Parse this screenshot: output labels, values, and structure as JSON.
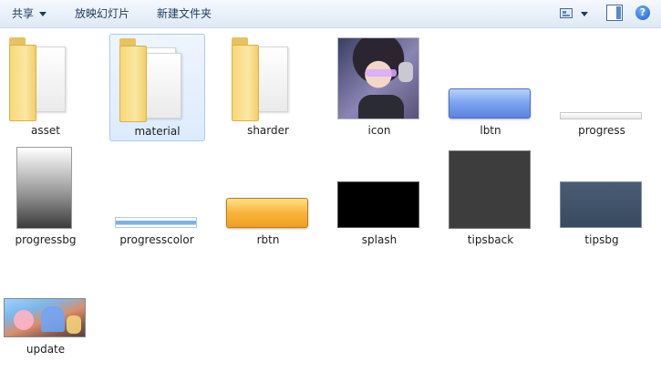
{
  "toolbar": {
    "share_label": "共享",
    "slideshow_label": "放映幻灯片",
    "new_folder_label": "新建文件夹",
    "help_glyph": "?"
  },
  "files": [
    {
      "name": "asset",
      "kind": "folder"
    },
    {
      "name": "material",
      "kind": "folder",
      "selected": true
    },
    {
      "name": "sharder",
      "kind": "folder"
    },
    {
      "name": "icon",
      "kind": "image"
    },
    {
      "name": "lbtn",
      "kind": "image"
    },
    {
      "name": "progress",
      "kind": "image"
    },
    {
      "name": "progressbg",
      "kind": "image"
    },
    {
      "name": "progresscolor",
      "kind": "image"
    },
    {
      "name": "rbtn",
      "kind": "image"
    },
    {
      "name": "splash",
      "kind": "image"
    },
    {
      "name": "tipsback",
      "kind": "image"
    },
    {
      "name": "tipsbg",
      "kind": "image"
    },
    {
      "name": "update",
      "kind": "image"
    }
  ],
  "colors": {
    "selection_border": "#a9cbf2",
    "selection_fill": "#dcebfc",
    "toolbar_text": "#1e395b"
  }
}
